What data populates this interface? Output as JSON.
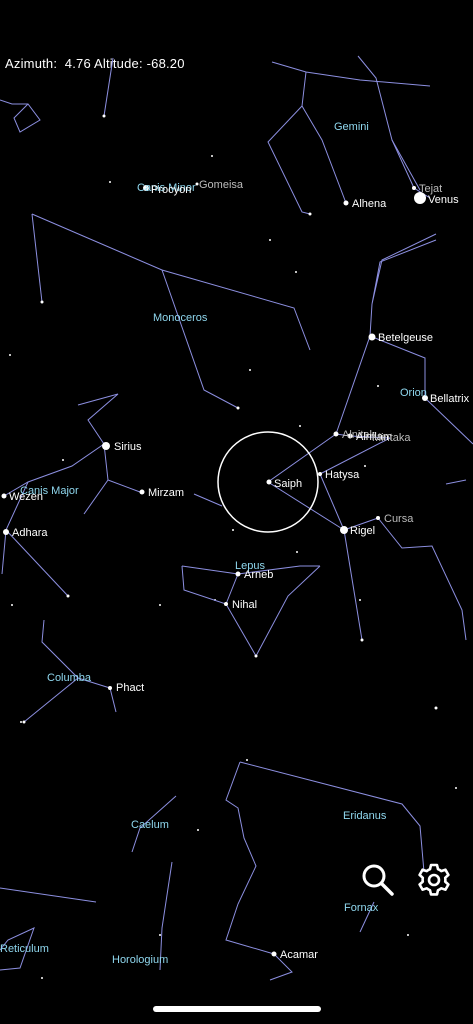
{
  "hud": {
    "azimuth_label": "Azimuth:",
    "azimuth_value": "4.76",
    "altitude_label": "Altitude:",
    "altitude_value": "-68.20"
  },
  "constellations": [
    "Gemini",
    "Canis Minor",
    "Monoceros",
    "Orion",
    "Canis Major",
    "Lepus",
    "Columba",
    "Caelum",
    "Eridanus",
    "Fornax",
    "Reticulum",
    "Horologium"
  ],
  "stars": [
    "Gomeisa",
    "Procyon",
    "Alhena",
    "Tejat",
    "Venus",
    "Betelgeuse",
    "Bellatrix",
    "Alnitak",
    "Alnilam",
    "Mintaka",
    "Sirius",
    "Mirzam",
    "Wezen",
    "Adhara",
    "Saiph",
    "Hatysa",
    "Rigel",
    "Cursa",
    "Arneb",
    "Nihal",
    "Phact",
    "Acamar"
  ],
  "controls": {
    "search_icon": "search-icon",
    "settings_icon": "gear-icon"
  },
  "colors": {
    "background": "#000000",
    "constellation_line": "#8c8fe0",
    "constellation_label": "#8fd7ee",
    "star": "#ffffff",
    "reticle": "#ffffff"
  }
}
